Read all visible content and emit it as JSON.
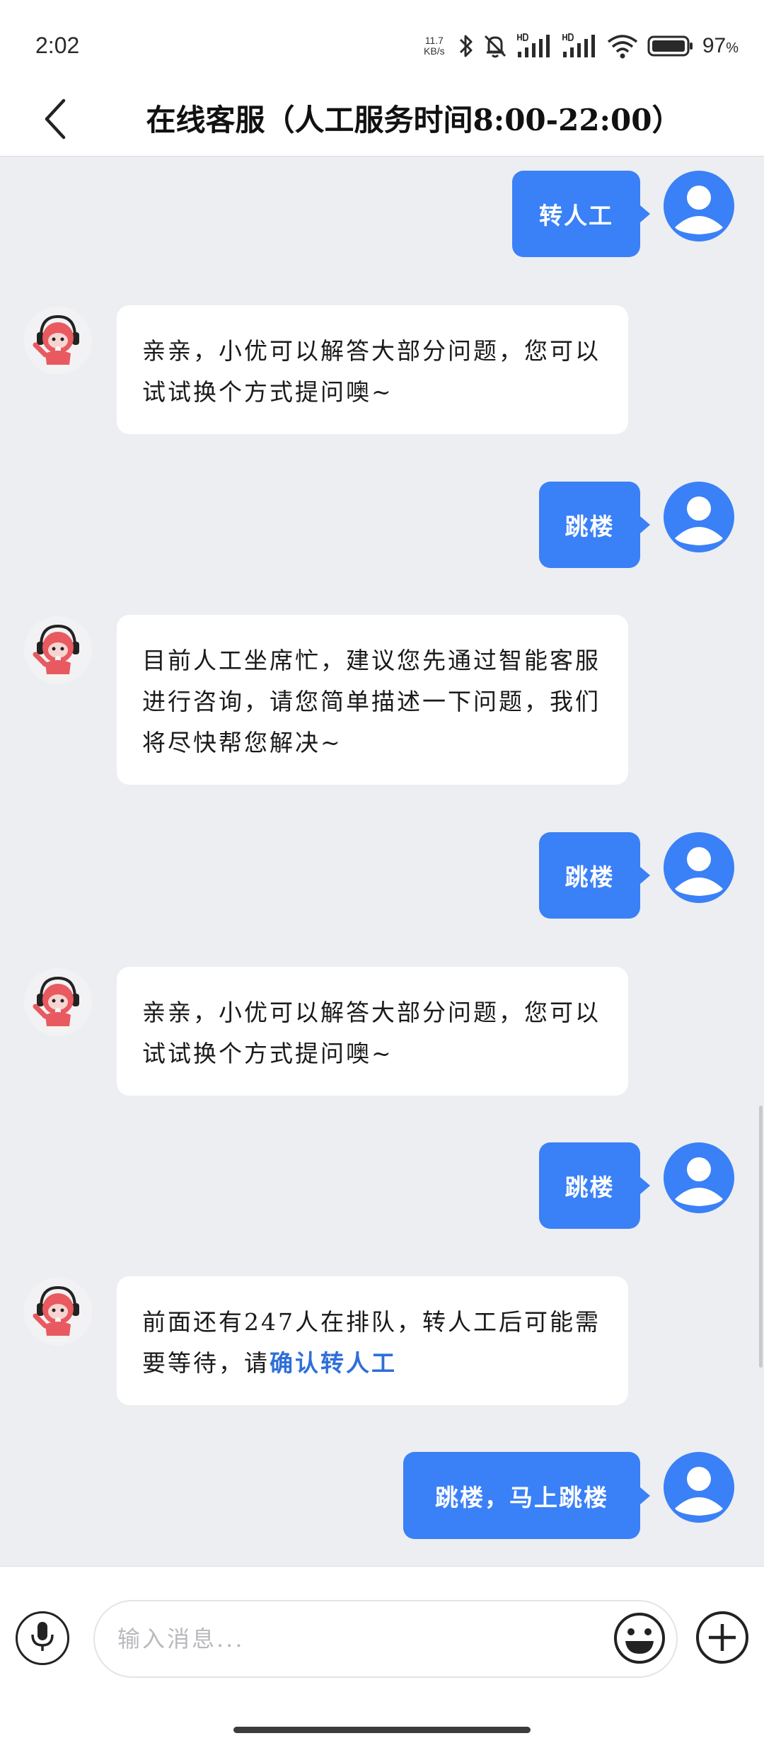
{
  "status_bar": {
    "time": "2:02",
    "net_speed_value": "11.7",
    "net_speed_unit": "KB/s",
    "battery_percent": "97",
    "battery_unit": "%",
    "icons": [
      "bluetooth-icon",
      "mute-bell-icon",
      "hd-signal-icon",
      "hd-signal-icon",
      "wifi-icon",
      "battery-icon"
    ]
  },
  "header": {
    "back_icon": "chevron-left-icon",
    "title": "在线客服（人工服务时间8:00-22:00）"
  },
  "messages": [
    {
      "sender": "user",
      "text": "转人工"
    },
    {
      "sender": "bot",
      "text": "亲亲，小优可以解答大部分问题，您可以试试换个方式提问噢~"
    },
    {
      "sender": "user",
      "text": "跳楼"
    },
    {
      "sender": "bot",
      "text": "目前人工坐席忙，建议您先通过智能客服进行咨询，请您简单描述一下问题，我们将尽快帮您解决~"
    },
    {
      "sender": "user",
      "text": "跳楼"
    },
    {
      "sender": "bot",
      "text": "亲亲，小优可以解答大部分问题，您可以试试换个方式提问噢~"
    },
    {
      "sender": "user",
      "text": "跳楼"
    },
    {
      "sender": "bot",
      "text": "前面还有247人在排队，转人工后可能需要等待，请",
      "link": "确认转人工"
    },
    {
      "sender": "user",
      "text": "跳楼，马上跳楼"
    }
  ],
  "input_bar": {
    "placeholder": "输入消息...",
    "value": "",
    "icons": [
      "microphone-icon",
      "emoji-icon",
      "plus-icon"
    ]
  },
  "colors": {
    "accent": "#3a80f7",
    "chat_background": "#edeef1",
    "link": "#2f6fd8"
  }
}
